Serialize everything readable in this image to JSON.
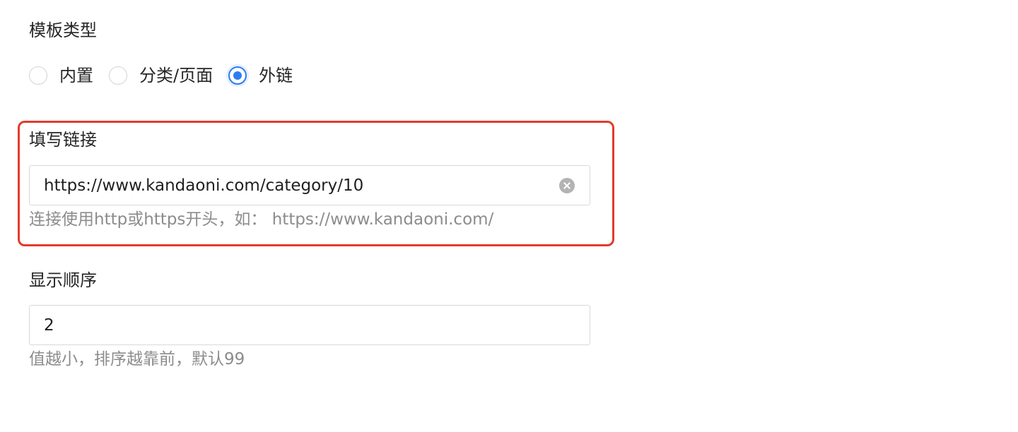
{
  "template_type": {
    "label": "模板类型",
    "options": [
      {
        "label": "内置",
        "checked": false
      },
      {
        "label": "分类/页面",
        "checked": false
      },
      {
        "label": "外链",
        "checked": true
      }
    ]
  },
  "link": {
    "label": "填写链接",
    "value": "https://www.kandaoni.com/category/10",
    "hint": "连接使用http或https开头，如： https://www.kandaoni.com/"
  },
  "display_order": {
    "label": "显示顺序",
    "value": "2",
    "hint": "值越小，排序越靠前，默认99"
  },
  "colors": {
    "accent": "#2f7cf0",
    "highlight_border": "#e23c2c",
    "hint_text": "#8c8c8c"
  }
}
